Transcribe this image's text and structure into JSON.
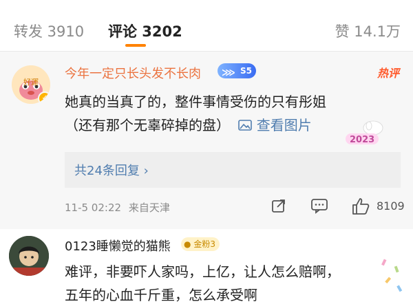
{
  "tabs": {
    "repost": "转发 3910",
    "comment": "评论 3202",
    "like": "赞 14.1万"
  },
  "comments": [
    {
      "avatar_label": "好運",
      "username": "今年一定只长头发不长肉",
      "vip_badge": "S5",
      "tag": "热评",
      "text_line1": "她真的当真了的，整件事情受伤的只有彤姐",
      "text_line2": "（还有那个无辜碎掉的盘）",
      "image_link": "查看图片",
      "sticker_text": "2023",
      "replies": "共24条回复 ›",
      "time": "11-5 02:22",
      "location": "来自天津",
      "likes": "8109"
    },
    {
      "username": "0123睡懒觉的猫熊",
      "fan_badge": "金粉3",
      "text_line1": "难评，非要吓人家吗，上亿，让人怎么赔啊，",
      "text_line2": "五年的心血千斤重，怎么承受啊"
    }
  ],
  "colors": {
    "accent": "#ff8200",
    "username_hot": "#eb7340",
    "link": "#507daf"
  },
  "icons": [
    "share-icon",
    "comment-icon",
    "like-icon",
    "image-icon",
    "vip-wing-icon",
    "verified-icon"
  ]
}
